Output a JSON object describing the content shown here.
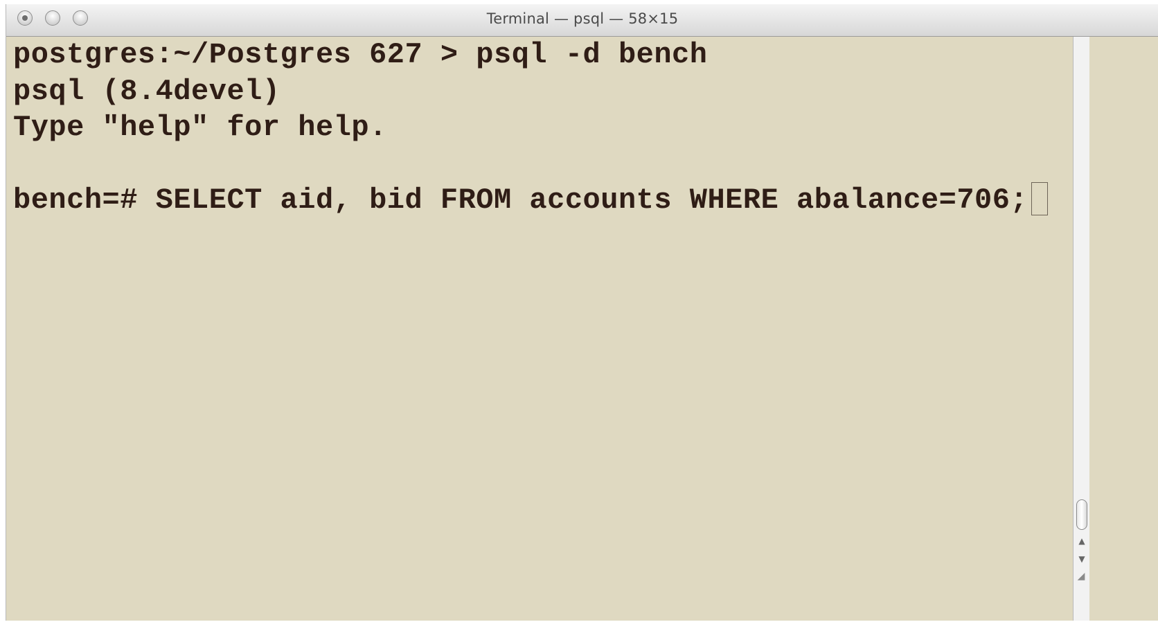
{
  "window": {
    "title": "Terminal — psql — 58×15"
  },
  "terminal": {
    "lines": [
      "postgres:~/Postgres 627 > psql -d bench",
      "psql (8.4devel)",
      "Type \"help\" for help.",
      "",
      "bench=# SELECT aid, bid FROM accounts WHERE abalance=706;"
    ],
    "colors": {
      "background": "#dfd9c1",
      "text": "#2f1d16"
    }
  },
  "scrollbar": {
    "up_arrow_glyph": "▲",
    "down_arrow_glyph": "▼",
    "resize_glyph": "◢"
  },
  "icons": {
    "close": "close-icon",
    "minimize": "minimize-icon",
    "zoom": "zoom-icon",
    "cursor": "cursor-block"
  }
}
